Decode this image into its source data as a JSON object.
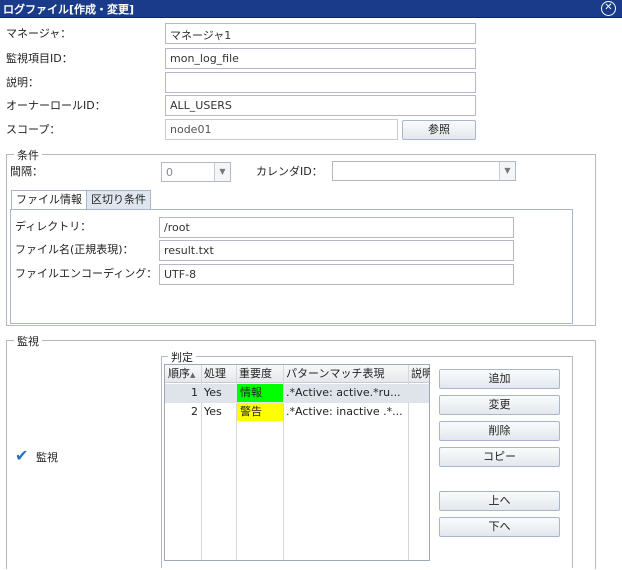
{
  "window": {
    "title": "ログファイル[作成・変更]",
    "close_icon": "close-icon"
  },
  "form": {
    "manager_label": "マネージャ：",
    "manager_value": "マネージャ1",
    "monitor_id_label": "監視項目ID：",
    "monitor_id_value": "mon_log_file",
    "description_label": "説明：",
    "description_value": "",
    "owner_role_label": "オーナーロールID：",
    "owner_role_value": "ALL_USERS",
    "scope_label": "スコープ：",
    "scope_value": "node01",
    "scope_button": "参照"
  },
  "conditions": {
    "legend": "条件",
    "interval_label": "間隔：",
    "interval_value": "0",
    "calendar_label": "カレンダID：",
    "calendar_value": "",
    "tabs": [
      {
        "label": "ファイル情報",
        "active": true
      },
      {
        "label": "区切り条件",
        "active": false
      }
    ],
    "directory_label": "ディレクトリ：",
    "directory_value": "/root",
    "filename_label": "ファイル名(正規表現)：",
    "filename_value": "result.txt",
    "encoding_label": "ファイルエンコーディング：",
    "encoding_value": "UTF-8"
  },
  "monitor": {
    "legend": "監視",
    "judge_legend": "判定",
    "columns": [
      "順序",
      "処理",
      "重要度",
      "パターンマッチ表現",
      "説明"
    ],
    "rows": [
      {
        "order": "1",
        "process": "Yes",
        "priority": "情報",
        "priority_color": "#00ff00",
        "pattern": ".*Active: active.*ru...",
        "description": ""
      },
      {
        "order": "2",
        "process": "Yes",
        "priority": "警告",
        "priority_color": "#ffff00",
        "pattern": ".*Active: inactive .*...",
        "description": ""
      }
    ],
    "buttons": {
      "add": "追加",
      "modify": "変更",
      "delete": "削除",
      "copy": "コピー",
      "up": "上へ",
      "down": "下へ"
    },
    "monitor_check_label": "監視",
    "monitor_checked": true
  }
}
